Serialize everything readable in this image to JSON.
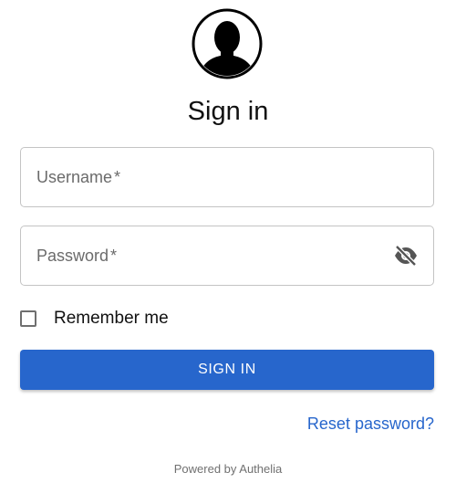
{
  "form": {
    "title": "Sign in",
    "username_label": "Username",
    "password_label": "Password",
    "required_mark": "*",
    "password_toggle_icon": "eye-slash-icon",
    "avatar_icon": "user-avatar-icon",
    "remember_label": "Remember me",
    "remember_checked": false,
    "submit_label": "SIGN IN",
    "reset_link": "Reset password?"
  },
  "footer": {
    "powered_by": "Powered by Authelia"
  },
  "colors": {
    "accent": "#2766cc",
    "border": "#c4c4c4",
    "placeholder": "#6b6b6b",
    "footer_text": "#707070"
  }
}
